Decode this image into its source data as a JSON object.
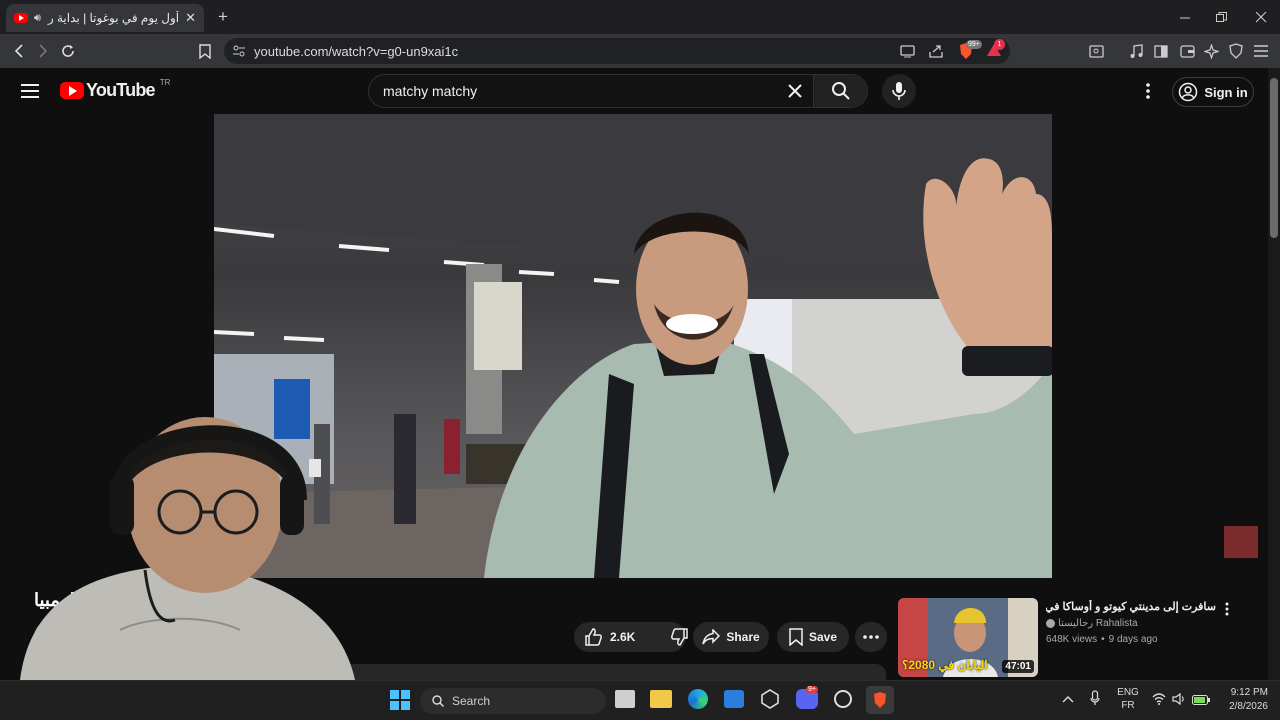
{
  "browser": {
    "tab_title": "أول يوم في بوغوتا | بداية رحلتي",
    "new_tab_symbol": "+",
    "url": "youtube.com/watch?v=g0-un9xai1c",
    "brave_badge": "99+",
    "rewards_badge": "1",
    "window_controls": [
      "minimize-icon",
      "restore-icon",
      "close-icon"
    ]
  },
  "youtube": {
    "logo_text": "YouTube",
    "region": "TR",
    "search_value": "matchy matchy",
    "sign_in_label": "Sign in"
  },
  "video": {
    "title_fragment": "كولومبيا",
    "actions": {
      "likes": "2.6K",
      "share": "Share",
      "save": "Save"
    }
  },
  "recommended": [
    {
      "title": "سافرت إلى مدينتي كيوتو و أوساكا في اليابان",
      "channel": "رحاليستا Rahalista",
      "views": "648K views",
      "age": "9 days ago",
      "duration": "47:01",
      "thumb_caption": "اليابان في 2080؟"
    }
  ],
  "taskbar": {
    "search_label": "Search",
    "lang_top": "ENG",
    "lang_bottom": "FR",
    "time": "9:12 PM",
    "date": "2/8/2026",
    "discord_badge": "9+"
  },
  "colors": {
    "youtube_red": "#ff0000",
    "brave_orange": "#fb542b",
    "bg": "#0f0f0f"
  }
}
